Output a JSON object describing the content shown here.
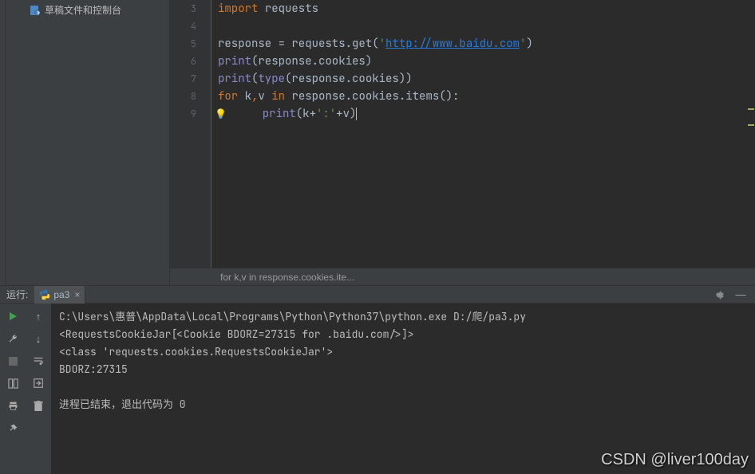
{
  "leftPanel": {
    "scratchLabel": "草稿文件和控制台"
  },
  "editor": {
    "gutter": [
      "3",
      "4",
      "5",
      "6",
      "7",
      "8",
      "9"
    ],
    "lines": [
      {
        "segments": [
          {
            "t": "import",
            "c": "kw"
          },
          {
            "t": " ",
            "c": "def"
          },
          {
            "t": "requests",
            "c": "def"
          }
        ]
      },
      {
        "segments": []
      },
      {
        "segments": [
          {
            "t": "response = requests.get(",
            "c": "def"
          },
          {
            "t": "'",
            "c": "str"
          },
          {
            "t": "http://www.baidu.com",
            "c": "url"
          },
          {
            "t": "'",
            "c": "str"
          },
          {
            "t": ")",
            "c": "def"
          }
        ]
      },
      {
        "segments": [
          {
            "t": "print",
            "c": "builtin"
          },
          {
            "t": "(response.cookies)",
            "c": "def"
          }
        ]
      },
      {
        "segments": [
          {
            "t": "print",
            "c": "builtin"
          },
          {
            "t": "(",
            "c": "def"
          },
          {
            "t": "type",
            "c": "builtin"
          },
          {
            "t": "(response.cookies))",
            "c": "def"
          }
        ]
      },
      {
        "segments": [
          {
            "t": "for",
            "c": "kw"
          },
          {
            "t": " k",
            "c": "def"
          },
          {
            "t": ",",
            "c": "kw"
          },
          {
            "t": "v ",
            "c": "def"
          },
          {
            "t": "in",
            "c": "kw"
          },
          {
            "t": " response.cookies.items():",
            "c": "def"
          }
        ]
      },
      {
        "segments": [
          {
            "t": "    ",
            "c": "def"
          },
          {
            "t": "print",
            "c": "builtin"
          },
          {
            "t": "(k+",
            "c": "def"
          },
          {
            "t": "':'",
            "c": "str"
          },
          {
            "t": "+v)",
            "c": "def"
          }
        ],
        "active": true,
        "bulb": true
      }
    ],
    "breadcrumb": "for k,v in response.cookies.ite..."
  },
  "run": {
    "label": "运行:",
    "tabName": "pa3",
    "output": [
      "C:\\Users\\惠普\\AppData\\Local\\Programs\\Python\\Python37\\python.exe D:/爬/pa3.py",
      "<RequestsCookieJar[<Cookie BDORZ=27315 for .baidu.com/>]>",
      "<class 'requests.cookies.RequestsCookieJar'>",
      "BDORZ:27315",
      "",
      "进程已结束，退出代码为 0"
    ]
  },
  "watermark": "CSDN @liver100day"
}
